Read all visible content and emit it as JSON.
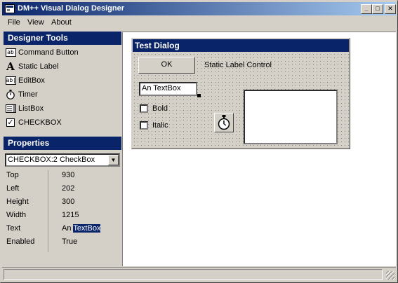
{
  "window": {
    "title": "DM++ Visual Dialog Designer",
    "icon": "app-icon",
    "controls": {
      "minimize": "_",
      "maximize": "□",
      "close": "✕"
    }
  },
  "menu": {
    "items": [
      "File",
      "View",
      "About"
    ]
  },
  "designer_tools": {
    "header": "Designer Tools",
    "items": [
      {
        "label": "Command Button",
        "icon": "command-button-icon"
      },
      {
        "label": "Static Label",
        "icon": "static-label-icon"
      },
      {
        "label": "EditBox",
        "icon": "editbox-icon"
      },
      {
        "label": "Timer",
        "icon": "stopwatch-icon"
      },
      {
        "label": "ListBox",
        "icon": "listbox-icon"
      },
      {
        "label": "CHECKBOX",
        "icon": "checkbox-icon"
      }
    ]
  },
  "properties": {
    "header": "Properties",
    "selected_control": "CHECKBOX:2  CheckBox",
    "rows": [
      {
        "key": "Top",
        "value": "930"
      },
      {
        "key": "Left",
        "value": "202"
      },
      {
        "key": "Height",
        "value": "300"
      },
      {
        "key": "Width",
        "value": "1215"
      },
      {
        "key": "Text",
        "value_prefix": "An ",
        "value_selected": "TextBox"
      },
      {
        "key": "Enabled",
        "value": "True"
      }
    ]
  },
  "test_dialog": {
    "title": "Test Dialog",
    "ok_button": "OK",
    "static_label": "Static Label Control",
    "editbox_value": "An TextBox",
    "checkboxes": [
      {
        "label": "Bold",
        "checked": false
      },
      {
        "label": "Italic",
        "checked": false
      }
    ]
  },
  "colors": {
    "accent": "#0a246a",
    "face": "#d4d0c8"
  }
}
